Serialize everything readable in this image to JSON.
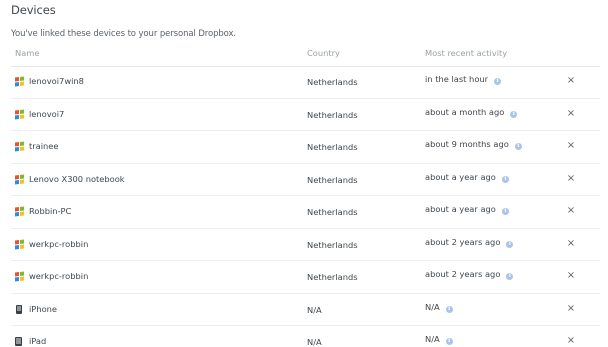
{
  "page": {
    "title": "Devices",
    "subtitle": "You've linked these devices to your personal Dropbox."
  },
  "table": {
    "headers": {
      "name": "Name",
      "country": "Country",
      "activity": "Most recent activity"
    },
    "remove_glyph": "×",
    "info_glyph": "i",
    "rows": [
      {
        "name": "lenovoi7win8",
        "type": "windows-icon",
        "country": "Netherlands",
        "activity": "in the last hour"
      },
      {
        "name": "lenovoi7",
        "type": "windows-icon",
        "country": "Netherlands",
        "activity": "about a month ago"
      },
      {
        "name": "trainee",
        "type": "windows-icon",
        "country": "Netherlands",
        "activity": "about 9 months ago"
      },
      {
        "name": "Lenovo X300 notebook",
        "type": "windows-icon",
        "country": "Netherlands",
        "activity": "about a year ago"
      },
      {
        "name": "Robbin-PC",
        "type": "windows-icon",
        "country": "Netherlands",
        "activity": "about a year ago"
      },
      {
        "name": "werkpc-robbin",
        "type": "windows-icon",
        "country": "Netherlands",
        "activity": "about 2 years ago"
      },
      {
        "name": "werkpc-robbin",
        "type": "windows-icon",
        "country": "Netherlands",
        "activity": "about 2 years ago"
      },
      {
        "name": "iPhone",
        "type": "phone-icon",
        "country": "N/A",
        "activity": "N/A"
      },
      {
        "name": "iPad",
        "type": "tablet-icon",
        "country": "N/A",
        "activity": "N/A"
      }
    ]
  },
  "colors": {
    "info_icon": "#a9c4e8",
    "divider": "#eceef0",
    "header_text": "#9aa1a6"
  }
}
